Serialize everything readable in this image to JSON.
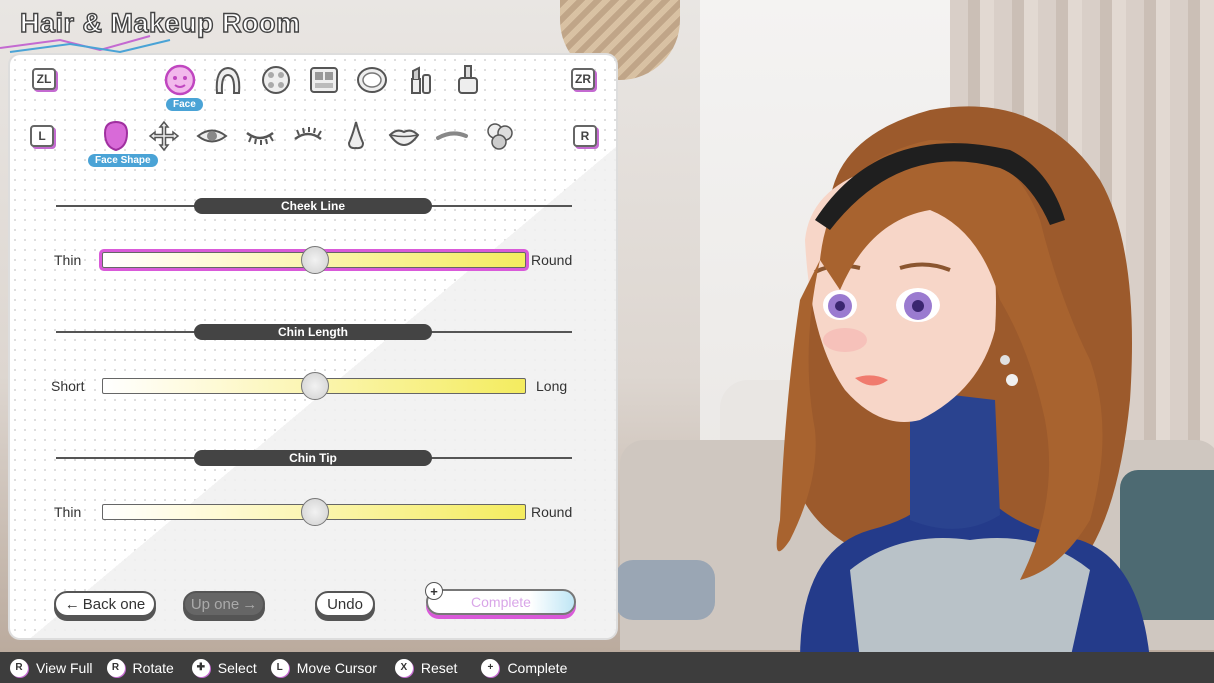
{
  "screen_title": "Hair & Makeup Room",
  "shoulder_buttons": {
    "zl": "ZL",
    "zr": "ZR",
    "l": "L",
    "r": "R"
  },
  "categories": [
    {
      "name": "face-icon",
      "label": "Face",
      "selected": true
    },
    {
      "name": "hair-icon"
    },
    {
      "name": "palette-icon"
    },
    {
      "name": "makeup-palette-icon"
    },
    {
      "name": "compact-icon"
    },
    {
      "name": "lipstick-icon"
    },
    {
      "name": "nail-polish-icon"
    }
  ],
  "subcategories": [
    {
      "name": "face-shape-icon",
      "label": "Face Shape",
      "selected": true
    },
    {
      "name": "move-icon"
    },
    {
      "name": "eye-icon"
    },
    {
      "name": "eyelash-lower-icon"
    },
    {
      "name": "eyelash-upper-icon"
    },
    {
      "name": "nose-icon"
    },
    {
      "name": "lips-icon"
    },
    {
      "name": "eyebrow-icon"
    },
    {
      "name": "blush-icon"
    }
  ],
  "sliders": [
    {
      "title": "Cheek Line",
      "left": "Thin",
      "right": "Round",
      "value": 0.5,
      "active": true
    },
    {
      "title": "Chin Length",
      "left": "Short",
      "right": "Long",
      "value": 0.5,
      "active": false
    },
    {
      "title": "Chin Tip",
      "left": "Thin",
      "right": "Round",
      "value": 0.5,
      "active": false
    }
  ],
  "buttons": {
    "back_one": "Back one",
    "up_one": "Up one",
    "undo": "Undo",
    "complete": "Complete",
    "plus": "+"
  },
  "controls": [
    {
      "icon": "R",
      "label": "View Full"
    },
    {
      "icon": "R",
      "label": "Rotate"
    },
    {
      "icon": "✚",
      "label": "Select"
    },
    {
      "icon": "L",
      "label": "Move Cursor"
    },
    {
      "icon": "X",
      "label": "Reset"
    },
    {
      "icon": "+",
      "label": "Complete"
    }
  ],
  "colors": {
    "accent_pink": "#d95ad9",
    "accent_blue": "#4aa3d6",
    "slider_yellow": "#f4ec5f"
  }
}
